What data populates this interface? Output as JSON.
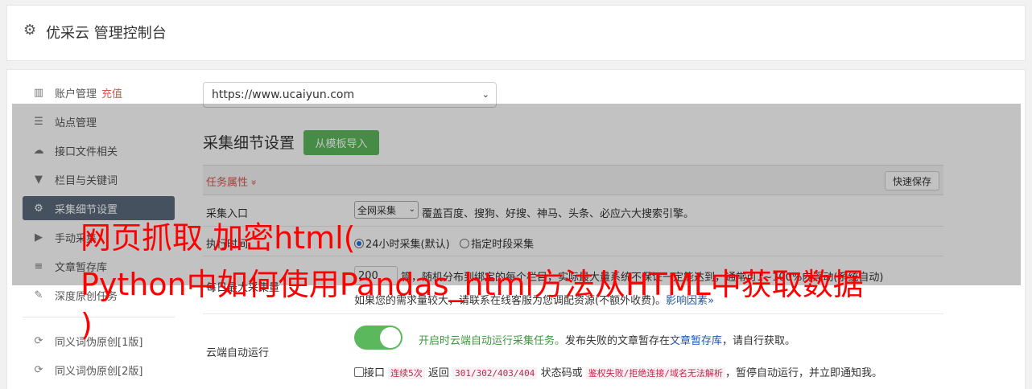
{
  "header": {
    "icon": "gear-icon",
    "title": "优采云 管理控制台"
  },
  "sidebar": {
    "items": [
      {
        "icon": "bar-chart-icon",
        "label": "账户管理",
        "extra": "充值"
      },
      {
        "icon": "server-icon",
        "label": "站点管理"
      },
      {
        "icon": "cloud-upload-icon",
        "label": "接口文件相关"
      },
      {
        "icon": "filter-icon",
        "label": "栏目与关键词"
      },
      {
        "icon": "cogs-icon",
        "label": "采集细节设置"
      },
      {
        "icon": "play-circle-icon",
        "label": "手动采集"
      },
      {
        "icon": "database-icon",
        "label": "文章暂存库"
      },
      {
        "icon": "edit-icon",
        "label": "深度原创任务"
      },
      {
        "icon": "refresh-icon",
        "label": "同义词伪原创[1版]"
      },
      {
        "icon": "refresh-icon",
        "label": "同义词伪原创[2版]"
      }
    ]
  },
  "site_select": {
    "value": "https://www.ucaiyun.com"
  },
  "section": {
    "title": "采集细节设置",
    "import_button": "从模板导入"
  },
  "task_props": {
    "label": "任务属性",
    "chevron": "»",
    "save_button": "快速保存"
  },
  "rows": {
    "entry": {
      "label": "采集入口",
      "select_value": "全网采集",
      "desc": "覆盖百度、搜狗、好搜、神马、头条、必应六大搜索引擎。"
    },
    "time": {
      "label": "执行时间",
      "option1": "24小时采集(默认)",
      "option2": "指定时段采集"
    },
    "count": {
      "label": "每日最大采集量",
      "value": "200",
      "desc": "篇，随机分布到绑定的每个栏目，实际最大量系统不保证一定能达到，通常可1~100%内浮动(系统自动)",
      "note": "如果您的需求量较大，请联系在线客服为您调配资源(不额外收费)。",
      "link": "影响因素"
    },
    "cloud": {
      "label": "云端自动运行",
      "toggle_text": "开启时云端自动运行采集任务。",
      "desc_before": "发布失败的文章暂存在",
      "link": "文章暂存库",
      "desc_after": "，请自行获取。",
      "cb_label": "接口",
      "code1": "连续5次",
      "txt1": "返回",
      "code2": "301/302/403/404",
      "txt2": "状态码或",
      "code3": "鉴权失败/拒绝连接/域名无法解析",
      "txt3": "，暂停自动运行，并立即通知我。"
    }
  },
  "watermark": {
    "line1": "网页抓取 加密html(",
    "line2": "Python中如何使用Pandas_html方法从HTML中获取数据",
    "line3": ")"
  }
}
